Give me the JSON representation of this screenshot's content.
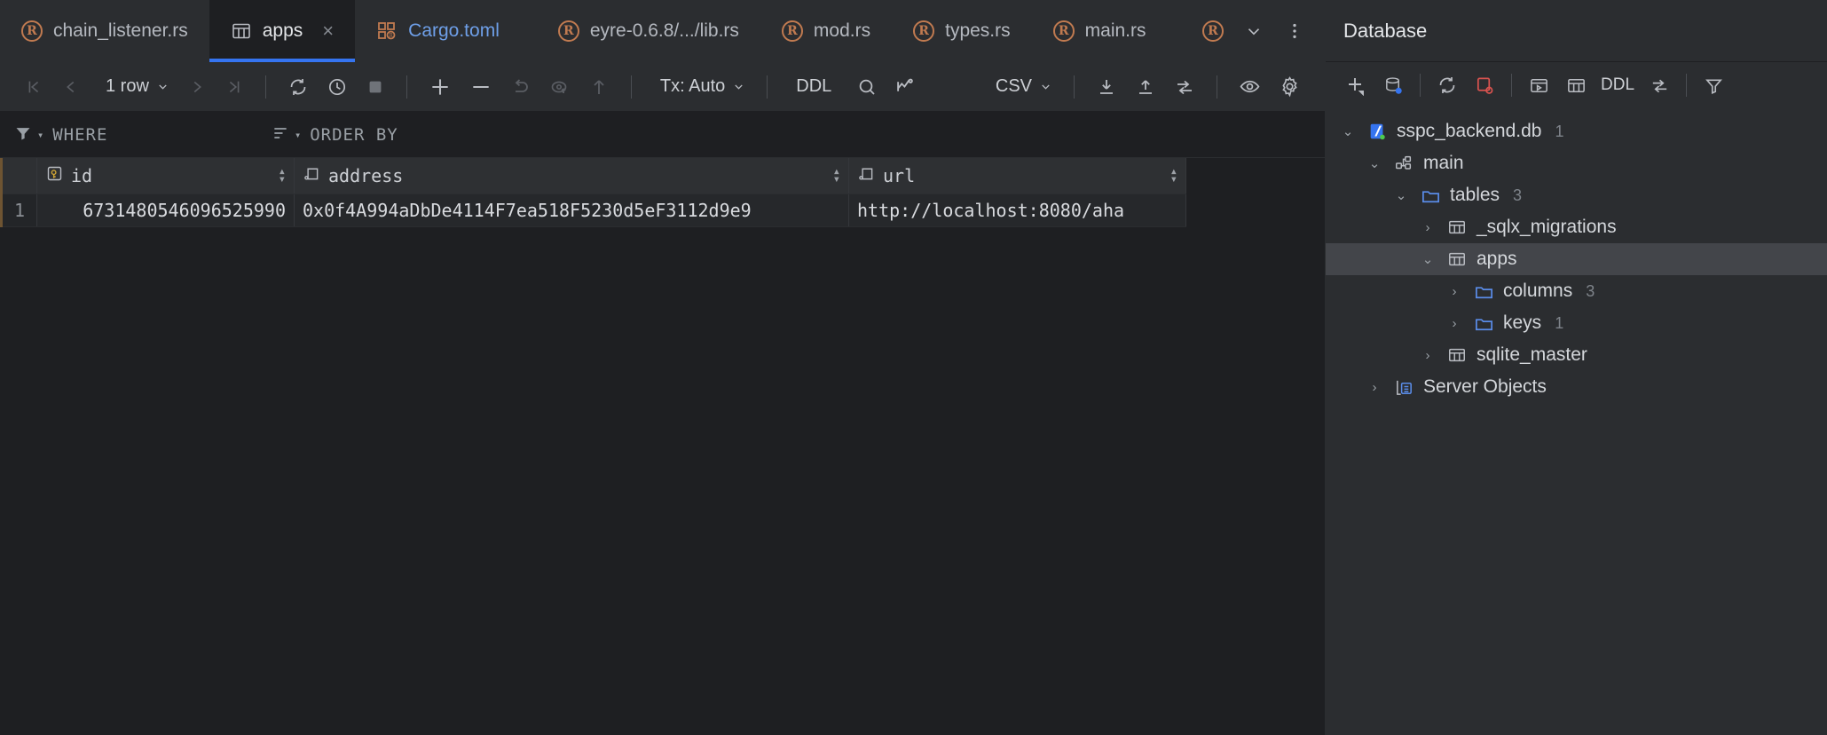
{
  "tabs": [
    {
      "label": "chain_listener.rs",
      "icon": "rust-icon",
      "active": false,
      "closeable": false
    },
    {
      "label": "apps",
      "icon": "table-grid-icon",
      "active": true,
      "closeable": true,
      "close_label": "×"
    },
    {
      "label": "Cargo.toml",
      "icon": "toml-icon",
      "active": false,
      "closeable": false
    },
    {
      "label": "eyre-0.6.8/.../lib.rs",
      "icon": "rust-icon",
      "active": false,
      "closeable": false
    },
    {
      "label": "mod.rs",
      "icon": "rust-icon",
      "active": false,
      "closeable": false
    },
    {
      "label": "types.rs",
      "icon": "rust-icon",
      "active": false,
      "closeable": false
    },
    {
      "label": "main.rs",
      "icon": "rust-icon",
      "active": false,
      "closeable": false
    }
  ],
  "tabbar_right": {
    "overflow_rust_icon": "rust-icon",
    "chevron_down": "⌄",
    "more_menu": "⋮"
  },
  "toolbar": {
    "first_page": "|‹",
    "prev_page": "‹",
    "row_count": "1 row",
    "row_count_caret": "⌄",
    "next_page": "›",
    "last_page": "›|",
    "refresh": "refresh-icon",
    "history": "history-icon",
    "stop": "stop-icon",
    "add_row": "+",
    "delete_row": "−",
    "revert": "revert-icon",
    "rollback": "rollback-icon",
    "submit": "⇧",
    "tx_label": "Tx: Auto",
    "tx_caret": "⌄",
    "ddl_label": "DDL",
    "search": "search-icon",
    "chart": "chart-icon",
    "export_format": "CSV",
    "export_caret": "⌄",
    "download": "download-icon",
    "upload": "upload-icon",
    "transfer": "data-transfer-icon",
    "preview": "eye-icon",
    "settings": "gear-icon"
  },
  "filterbar": {
    "where_label": "WHERE",
    "where_icon": "filter-icon",
    "order_label": "ORDER BY",
    "order_icon": "sort-icon",
    "caret": "▾"
  },
  "grid": {
    "columns": [
      {
        "name": "id",
        "icon": "primary-key-icon",
        "sortable": true
      },
      {
        "name": "address",
        "icon": "column-icon",
        "sortable": true
      },
      {
        "name": "url",
        "icon": "column-icon",
        "sortable": true
      }
    ],
    "rows": [
      {
        "num": "1",
        "id": "6731480546096525990",
        "address": "0x0f4A994aDbDe4114F7ea518F5230d5eF3112d9e9",
        "url": "http://localhost:8080/aha"
      }
    ],
    "sort_glyph_up": "▴",
    "sort_glyph_down": "▾"
  },
  "database": {
    "title": "Database",
    "toolbar": {
      "new": "+",
      "data_source": "data-source-icon",
      "refresh": "refresh-icon",
      "stop": "stop-red-icon",
      "console": "console-icon",
      "table": "table-icon",
      "ddl": "DDL",
      "transfer": "data-transfer-icon",
      "filter": "filter-icon"
    },
    "tree": [
      {
        "label": "sspc_backend.db",
        "badge": "1",
        "icon": "sqlite-db-icon",
        "twisty": "⌄",
        "depth": 0,
        "selected": false
      },
      {
        "label": "main",
        "badge": "",
        "icon": "schema-icon",
        "twisty": "⌄",
        "depth": 1,
        "selected": false
      },
      {
        "label": "tables",
        "badge": "3",
        "icon": "folder-icon",
        "twisty": "⌄",
        "depth": 2,
        "selected": false
      },
      {
        "label": "_sqlx_migrations",
        "badge": "",
        "icon": "table-icon",
        "twisty": "›",
        "depth": 3,
        "selected": false
      },
      {
        "label": "apps",
        "badge": "",
        "icon": "table-icon",
        "twisty": "⌄",
        "depth": 3,
        "selected": true
      },
      {
        "label": "columns",
        "badge": "3",
        "icon": "folder-icon",
        "twisty": "›",
        "depth": 4,
        "selected": false
      },
      {
        "label": "keys",
        "badge": "1",
        "icon": "folder-icon",
        "twisty": "›",
        "depth": 4,
        "selected": false
      },
      {
        "label": "sqlite_master",
        "badge": "",
        "icon": "table-icon",
        "twisty": "›",
        "depth": 3,
        "selected": false
      },
      {
        "label": "Server Objects",
        "badge": "",
        "icon": "server-objects-icon",
        "twisty": "›",
        "depth": 1,
        "selected": false
      }
    ]
  },
  "colors": {
    "accent_blue": "#3574f0",
    "toml_blue": "#6e9fe8",
    "rust_orange": "#c07a50",
    "folder_blue": "#5a8ce8",
    "key_gold": "#d6a котор"
  }
}
